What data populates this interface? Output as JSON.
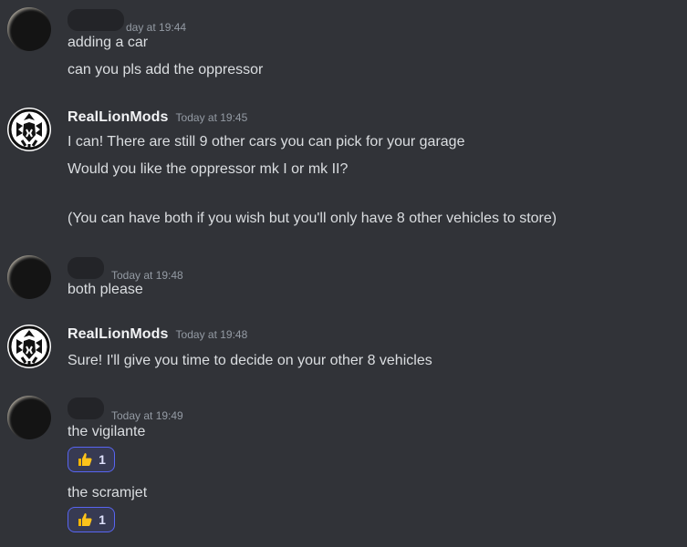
{
  "messages": [
    {
      "id": "m1",
      "author": "",
      "timestamp": "Today at 19:44",
      "timestamp_visible": "day at 19:44",
      "lines": [
        "adding a car",
        "can you pls add the oppressor"
      ]
    },
    {
      "id": "m2",
      "author": "RealLionMods",
      "timestamp": "Today at 19:45",
      "lines": [
        "I can! There are still 9 other cars you can pick for your garage",
        "Would you like the oppressor mk I or mk II?",
        "(You can have both if you wish but you'll only have 8 other vehicles to store)"
      ]
    },
    {
      "id": "m3",
      "author": "",
      "timestamp": "Today at 19:48",
      "lines": [
        "both please"
      ]
    },
    {
      "id": "m4",
      "author": "RealLionMods",
      "timestamp": "Today at 19:48",
      "lines": [
        "Sure! I'll give you time to decide on your other 8 vehicles"
      ]
    },
    {
      "id": "m5",
      "author": "",
      "timestamp": "Today at 19:49",
      "lines": [
        "the vigilante",
        "the scramjet"
      ],
      "reactions": [
        {
          "emoji": "thumbs-up",
          "count": "1"
        },
        {
          "emoji": "thumbs-up",
          "count": "1"
        }
      ]
    }
  ],
  "colors": {
    "background": "#313338",
    "text": "#dbdee1",
    "username": "#f2f3f5",
    "timestamp": "#949ba4",
    "reaction_border": "#5865f2",
    "reaction_bg": "#373a53"
  }
}
